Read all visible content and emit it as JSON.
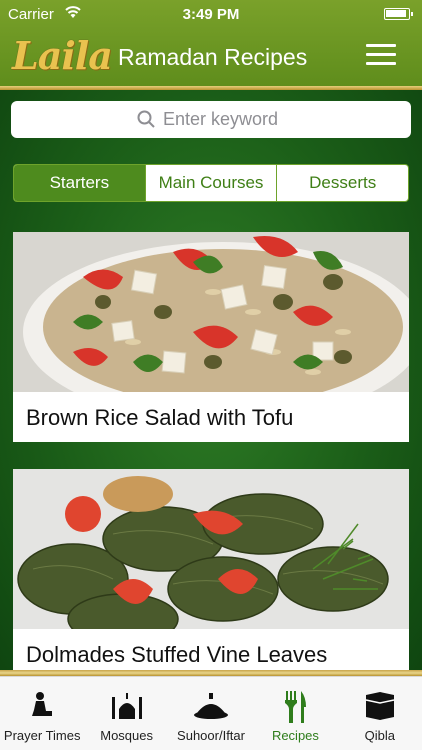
{
  "status": {
    "carrier": "Carrier",
    "time": "3:49 PM"
  },
  "header": {
    "logo": "Laila",
    "title": "Ramadan Recipes"
  },
  "search": {
    "placeholder": "Enter keyword"
  },
  "segments": {
    "starters": "Starters",
    "main_courses": "Main Courses",
    "desserts": "Desserts",
    "selected": "Starters"
  },
  "recipes": [
    {
      "title": "Brown Rice Salad with Tofu"
    },
    {
      "title": "Dolmades Stuffed Vine Leaves"
    }
  ],
  "tabs": [
    {
      "label": "Prayer Times",
      "icon": "prayer-icon"
    },
    {
      "label": "Mosques",
      "icon": "mosque-icon"
    },
    {
      "label": "Suhoor/Iftar",
      "icon": "dish-icon"
    },
    {
      "label": "Recipes",
      "icon": "fork-knife-icon",
      "active": true
    },
    {
      "label": "Qibla",
      "icon": "kaaba-icon"
    }
  ],
  "colors": {
    "header_green": "#6a9624",
    "accent_green": "#4e8b1e",
    "gold": "#d9bd63"
  }
}
